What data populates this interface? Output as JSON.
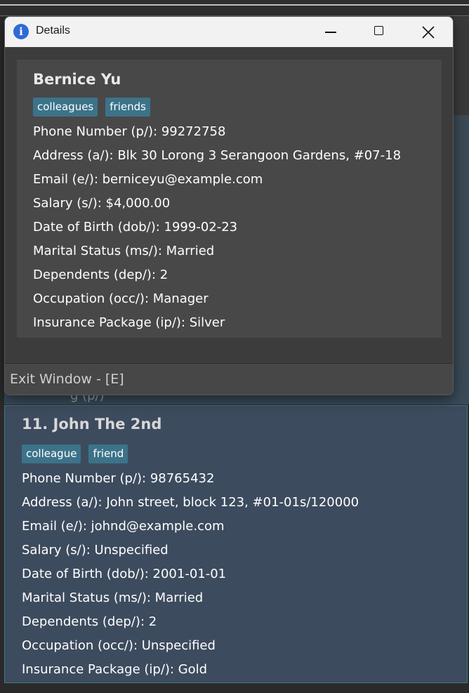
{
  "dialog": {
    "title": "Details",
    "exit_label": "Exit Window - [E]",
    "person": {
      "name": "Bernice Yu",
      "tags": [
        "colleagues",
        "friends"
      ],
      "fields": [
        "Phone Number (p/): 99272758",
        "Address (a/): Blk 30 Lorong 3 Serangoon Gardens, #07-18",
        "Email (e/): berniceyu@example.com",
        "Salary (s/): $4,000.00",
        "Date of Birth (dob/): 1999-02-23",
        "Marital Status (ms/): Married",
        "Dependents (dep/): 2",
        "Occupation (occ/): Manager",
        "Insurance Package (ip/): Silver"
      ]
    }
  },
  "list": {
    "card": {
      "title": "11. John The 2nd",
      "tags": [
        "colleague",
        "friend"
      ],
      "fields": [
        "Phone Number (p/): 98765432",
        "Address (a/): John street, block 123, #01-01s/120000",
        "Email (e/): johnd@example.com",
        "Salary (s/): Unspecified",
        "Date of Birth (dob/): 2001-01-01",
        "Marital Status (ms/): Married",
        "Dependents (dep/): 2",
        "Occupation (occ/): Unspecified",
        "Insurance Package (ip/): Gold"
      ]
    }
  },
  "colors": {
    "tag_bg": "#3c7389",
    "card_bg": "#3d4b5e",
    "dialog_bg": "#3c3c3c"
  }
}
